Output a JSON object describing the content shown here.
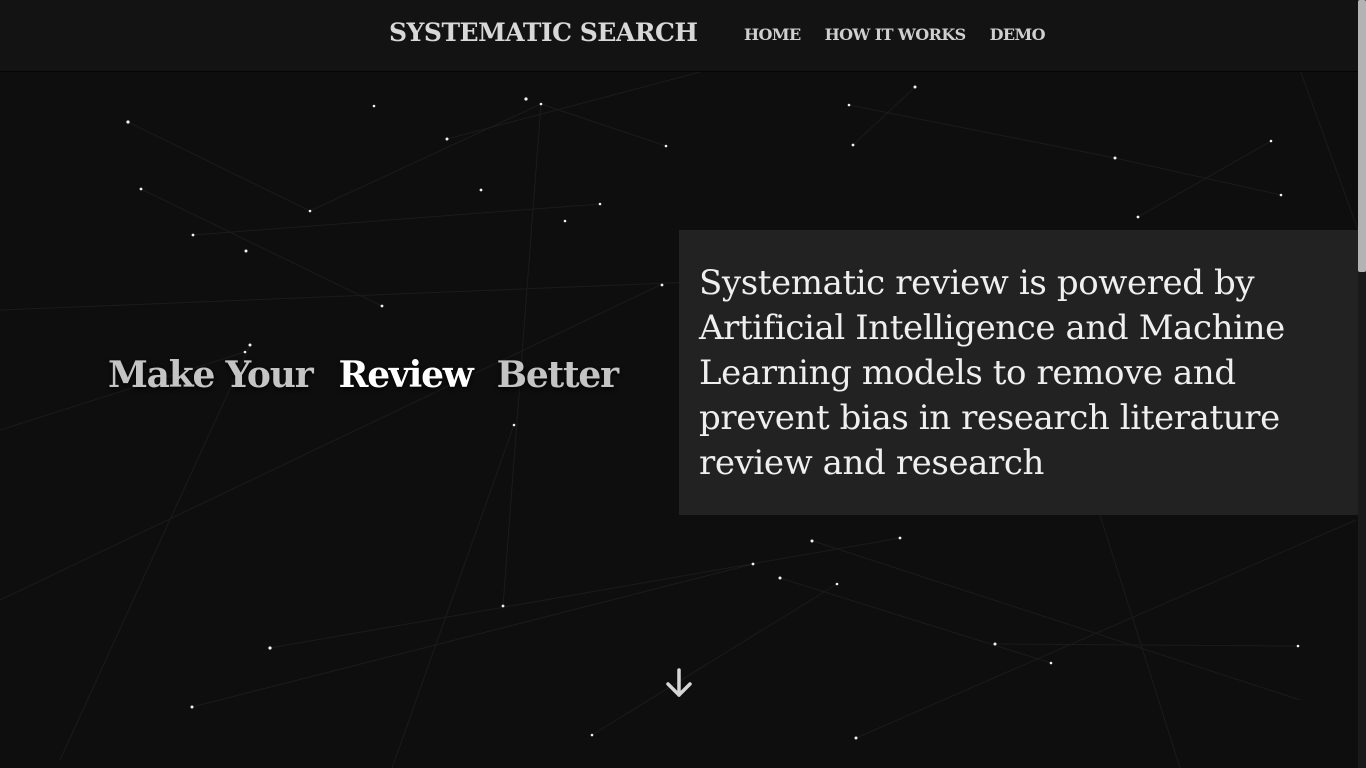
{
  "navbar": {
    "brand": "SYSTEMATIC SEARCH",
    "links": [
      {
        "label": "HOME"
      },
      {
        "label": "HOW IT WORKS"
      },
      {
        "label": "DEMO"
      }
    ]
  },
  "hero": {
    "tagline": [
      "Make Your",
      "Review",
      "Better"
    ],
    "description": "Systematic review is powered by Artificial Intelligence and Machine Learning models to remove and prevent bias in research literature review and research",
    "scroll_icon": "arrow-down-icon"
  },
  "colors": {
    "background": "#0e0e0e",
    "navbar": "#131313",
    "panel": "#242424",
    "text": "#efefef",
    "highlight": "#ffffff",
    "muted": "#c4c4c4"
  }
}
